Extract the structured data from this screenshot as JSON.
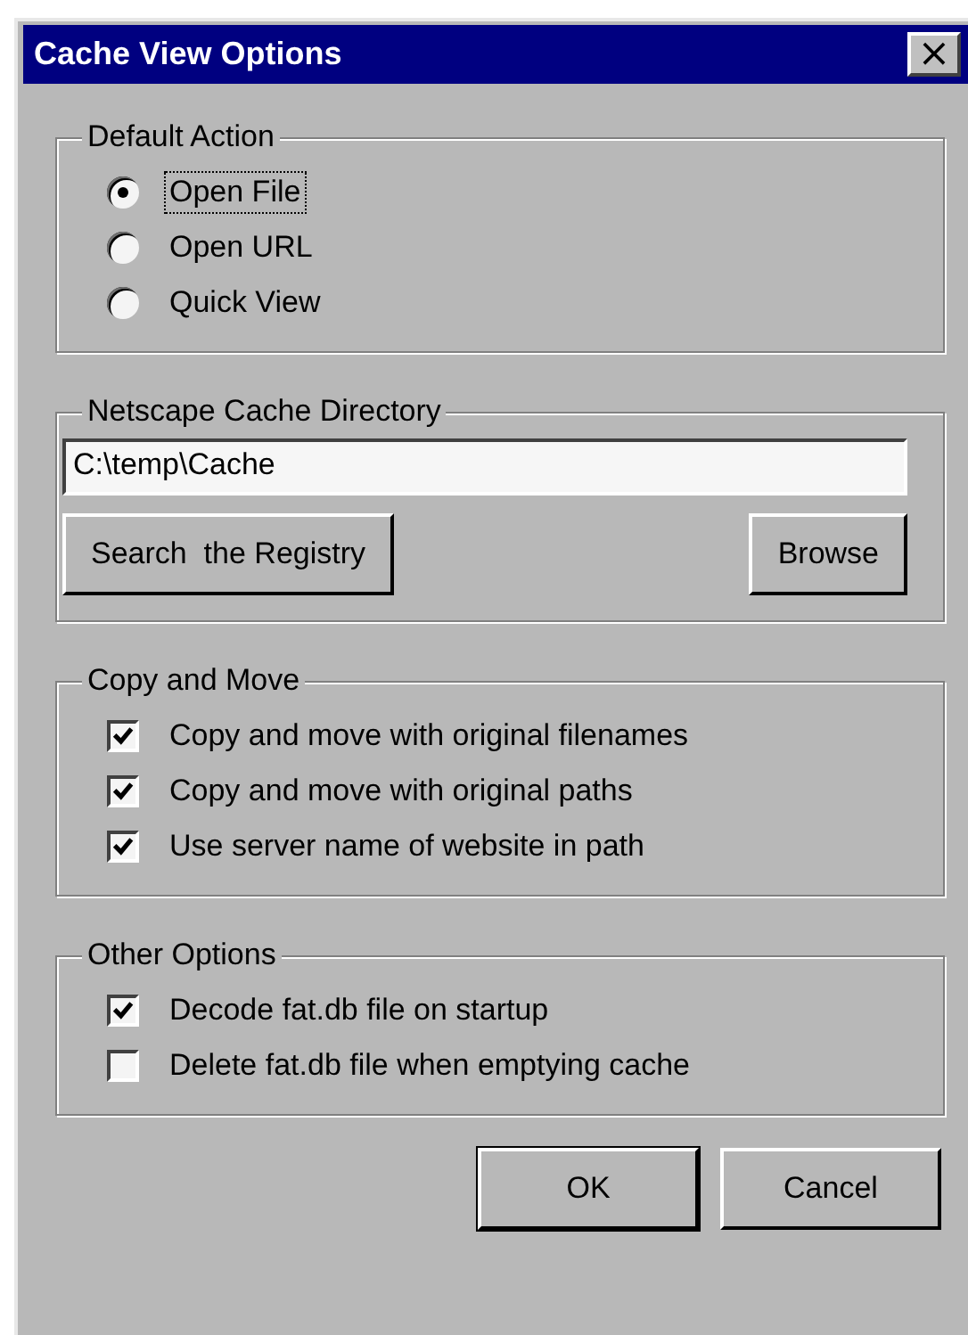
{
  "window": {
    "title": "Cache View Options",
    "close": "×"
  },
  "groups": [
    {
      "kind": "radios",
      "title": "Default Action",
      "items": [
        {
          "label": "Open File",
          "selected": true,
          "focused": true
        },
        {
          "label": "Open URL",
          "selected": false,
          "focused": false
        },
        {
          "label": "Quick View",
          "selected": false,
          "focused": false
        }
      ]
    },
    {
      "kind": "directory",
      "title": "Netscape Cache Directory",
      "value": "C:\\temp\\Cache",
      "buttons": [
        "Search  the Registry",
        "Browse"
      ]
    },
    {
      "kind": "checks",
      "title": "Copy and Move",
      "items": [
        {
          "label": "Copy and move with original filenames",
          "checked": true
        },
        {
          "label": "Copy and move with original paths",
          "checked": true
        },
        {
          "label": "Use server name of website in path",
          "checked": true
        }
      ]
    },
    {
      "kind": "checks",
      "title": "Other Options",
      "items": [
        {
          "label": "Decode fat.db file on startup",
          "checked": true
        },
        {
          "label": "Delete fat.db file when emptying cache",
          "checked": false
        }
      ]
    }
  ],
  "buttons": [
    {
      "label": "OK",
      "default": true
    },
    {
      "label": "Cancel",
      "default": false
    }
  ]
}
